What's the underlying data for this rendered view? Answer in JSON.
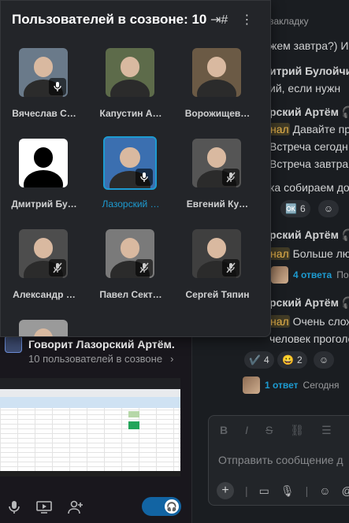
{
  "popover": {
    "title": "Пользователей в созвоне: 10",
    "icons": [
      "add-channel-icon",
      "more-vertical-icon"
    ],
    "participants": [
      {
        "name": "Вячеслав С…",
        "mic": "on",
        "bg": "#6a7a8a"
      },
      {
        "name": "Капустин А…",
        "mic": "none",
        "bg": "#5d6b4a"
      },
      {
        "name": "Ворожищев…",
        "mic": "none",
        "bg": "#6b5a45"
      },
      {
        "name": "Дмитрий Бу…",
        "mic": "none",
        "bg": "#ffffff"
      },
      {
        "name": "Лазорский …",
        "mic": "on",
        "bg": "#3b6fb0",
        "active": true
      },
      {
        "name": "Евгений Ку…",
        "mic": "off",
        "bg": "#555555"
      },
      {
        "name": "Александр …",
        "mic": "off",
        "bg": "#4d4d4d"
      },
      {
        "name": "Павел Сект…",
        "mic": "off",
        "bg": "#7a7a7a"
      },
      {
        "name": "Сергей Тяпин",
        "mic": "off",
        "bg": "#3f3f3f"
      },
      {
        "name": "",
        "mic": "none",
        "bg": "#9a9a9a"
      }
    ]
  },
  "sidebar": {
    "talking": "Говорит Лазорский Артём.",
    "count": "10 пользователей в созвоне",
    "count_chevron": "›"
  },
  "chat": {
    "bookmark": "закладку",
    "lines": [
      {
        "text": "жем завтра?) И"
      },
      {
        "sender": "итрий Булойчик"
      },
      {
        "text": "ий, если нужн"
      },
      {
        "sender": "рский Артём",
        "icon": "headphones-icon"
      },
      {
        "mention": "нал",
        "text": " Давайте пр"
      },
      {
        "text": "Встреча сегодн"
      },
      {
        "text": "Встреча завтра"
      },
      {
        "text": "ка собираем до"
      },
      {
        "sender": "рский Артём",
        "icon": "headphones-icon"
      },
      {
        "mention": "нал",
        "text": " Больше лю"
      },
      {
        "sender": "рский Артём",
        "icon": "headphones-icon"
      },
      {
        "mention": "нал",
        "text": " Очень слож"
      },
      {
        "text": "человек проголосо"
      }
    ],
    "reactions1": [
      {
        "emoji": "🆗",
        "count": "6"
      }
    ],
    "thread1": {
      "link": "4 ответа",
      "meta": "По"
    },
    "reactions2": [
      {
        "emoji": "✔️",
        "count": "4"
      },
      {
        "emoji": "😀",
        "count": "2"
      }
    ],
    "thread2": {
      "link": "1 ответ",
      "meta": "Сегодня"
    },
    "composer": {
      "placeholder": "Отправить сообщение д",
      "format_icons": [
        "B",
        "I",
        "S",
        "link",
        "list"
      ]
    }
  },
  "colors": {
    "accent": "#1d9bd1",
    "mention": "#e8b34b",
    "headset": "#1264a3"
  }
}
